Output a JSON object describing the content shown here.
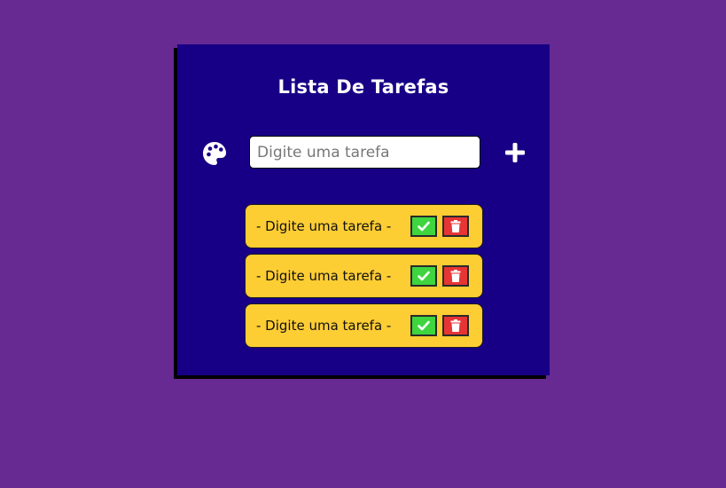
{
  "app": {
    "title": "Lista De Tarefas"
  },
  "input": {
    "placeholder": "Digite uma tarefa",
    "value": ""
  },
  "icons": {
    "palette": "palette-icon",
    "add": "plus-icon",
    "check": "check-icon",
    "trash": "trash-icon"
  },
  "tasks": [
    {
      "label": "- Digite uma tarefa -"
    },
    {
      "label": "- Digite uma tarefa -"
    },
    {
      "label": "- Digite uma tarefa -"
    }
  ],
  "colors": {
    "background": "#662a92",
    "card": "#180086",
    "task": "#fdcd34",
    "check": "#3ed53f",
    "trash": "#e63535"
  }
}
